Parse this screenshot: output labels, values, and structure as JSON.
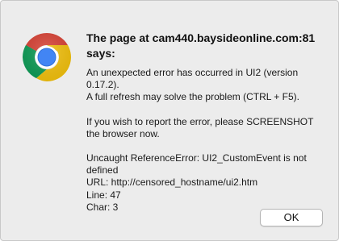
{
  "dialog": {
    "icon": "chrome-logo-icon",
    "title": "The page at cam440.baysideonline.com:81 says:",
    "paragraphs": [
      {
        "lines": [
          "An unexpected error has occurred in UI2 (version 0.17.2).",
          "A full refresh may solve the problem (CTRL + F5)."
        ]
      },
      {
        "lines": [
          "If you wish to report the error, please SCREENSHOT the browser now."
        ]
      },
      {
        "lines": [
          "Uncaught ReferenceError: UI2_CustomEvent is not defined",
          "URL: http://censored_hostname/ui2.htm",
          "Line: 47",
          "Char: 3"
        ]
      }
    ],
    "ok_label": "OK"
  },
  "colors": {
    "dialog_background": "#ececec",
    "chrome_red": "#db4437",
    "chrome_yellow": "#f4c20d",
    "chrome_green": "#0f9d58",
    "chrome_blue": "#4285f4"
  }
}
